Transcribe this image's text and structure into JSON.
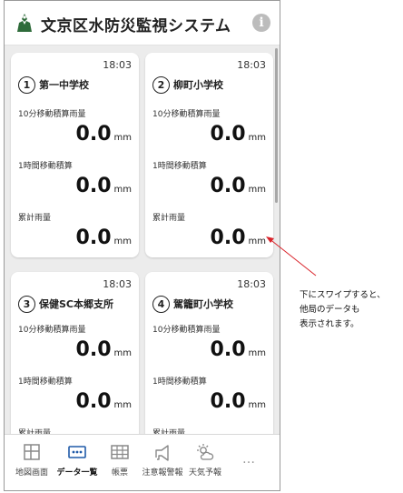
{
  "header": {
    "title": "文京区水防災監視システム"
  },
  "cards": [
    {
      "number": "1",
      "name": "第一中学校",
      "time": "18:03",
      "metrics": [
        {
          "label": "10分移動積算雨量",
          "value": "0.0",
          "unit": "mm"
        },
        {
          "label": "1時間移動積算",
          "value": "0.0",
          "unit": "mm"
        },
        {
          "label": "累計雨量",
          "value": "0.0",
          "unit": "mm"
        }
      ]
    },
    {
      "number": "2",
      "name": "柳町小学校",
      "time": "18:03",
      "metrics": [
        {
          "label": "10分移動積算雨量",
          "value": "0.0",
          "unit": "mm"
        },
        {
          "label": "1時間移動積算",
          "value": "0.0",
          "unit": "mm"
        },
        {
          "label": "累計雨量",
          "value": "0.0",
          "unit": "mm"
        }
      ]
    },
    {
      "number": "3",
      "name": "保健SC本郷支所",
      "time": "18:03",
      "metrics": [
        {
          "label": "10分移動積算雨量",
          "value": "0.0",
          "unit": "mm"
        },
        {
          "label": "1時間移動積算",
          "value": "0.0",
          "unit": "mm"
        },
        {
          "label": "累計雨量",
          "value": "",
          "unit": ""
        }
      ]
    },
    {
      "number": "4",
      "name": "駕籠町小学校",
      "time": "18:03",
      "metrics": [
        {
          "label": "10分移動積算雨量",
          "value": "0.0",
          "unit": "mm"
        },
        {
          "label": "1時間移動積算",
          "value": "0.0",
          "unit": "mm"
        },
        {
          "label": "累計雨量",
          "value": "",
          "unit": ""
        }
      ]
    }
  ],
  "tabs": [
    {
      "label": "地図画面",
      "icon": "map-icon",
      "active": false
    },
    {
      "label": "データ一覧",
      "icon": "data-list-icon",
      "active": true
    },
    {
      "label": "帳票",
      "icon": "report-icon",
      "active": false
    },
    {
      "label": "注意報警報",
      "icon": "warning-icon",
      "active": false
    },
    {
      "label": "天気予報",
      "icon": "weather-icon",
      "active": false
    }
  ],
  "more_label": "…",
  "annotation": {
    "lines": [
      "下にスワイプすると、",
      "他局のデータも",
      "表示されます。"
    ]
  },
  "colors": {
    "logo": "#2e6b3a",
    "active_tab": "#1f5aa8",
    "background": "#ececec",
    "arrow": "#d9232a"
  }
}
